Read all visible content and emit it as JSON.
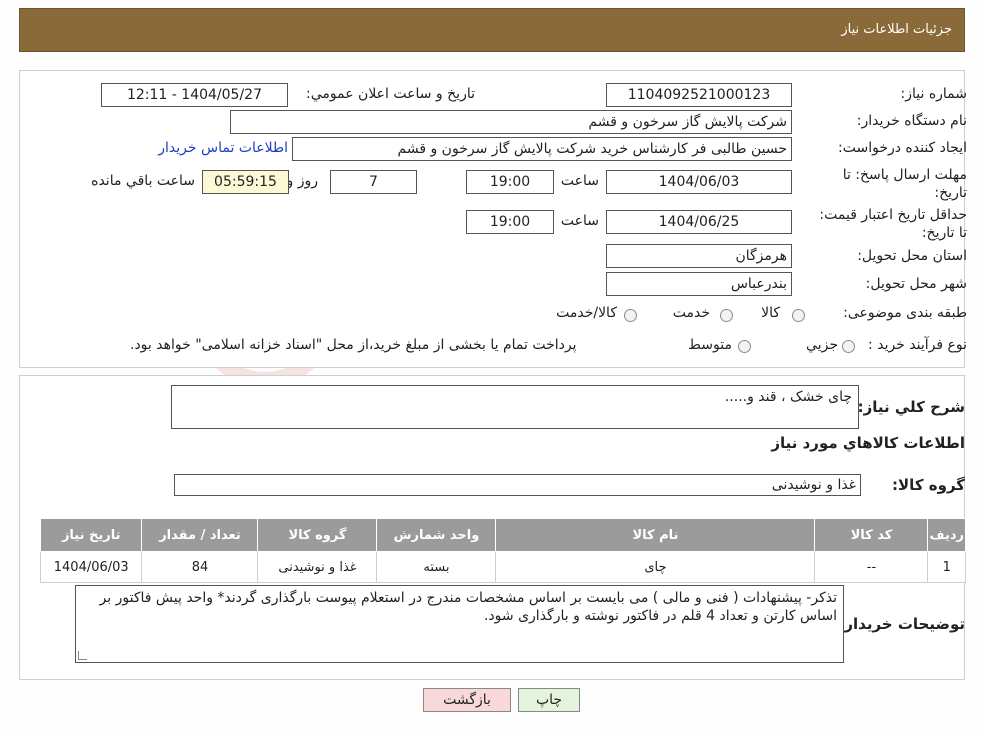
{
  "header": {
    "title": "جزئیات اطلاعات نیاز"
  },
  "info": {
    "need_number_label": "شماره نیاز:",
    "need_number": "1104092521000123",
    "announce_label": "تاریخ و ساعت اعلان عمومي:",
    "announce_value": "1404/05/27 - 12:11",
    "buyer_org_label": "نام دستگاه خریدار:",
    "buyer_org": "شرکت پالایش گاز سرخون و قشم",
    "creator_label": "ایجاد کننده درخواست:",
    "creator": "حسین طالبی فر کارشناس خرید شرکت پالایش گاز سرخون و قشم",
    "contact_link": "اطلاعات تماس خریدار",
    "deadline_label": "مهلت ارسال پاسخ: تا تاریخ:",
    "deadline_date": "1404/06/03",
    "time_label": "ساعت",
    "deadline_time": "19:00",
    "days": "7",
    "days_label": "روز و",
    "remaining": "05:59:15",
    "remaining_label": "ساعت باقي مانده",
    "price_validity_label": "حداقل تاریخ اعتبار قیمت: تا تاریخ:",
    "price_validity_date": "1404/06/25",
    "price_validity_time": "19:00",
    "province_label": "استان محل تحویل:",
    "province": "هرمزگان",
    "city_label": "شهر محل تحویل:",
    "city": "بندرعباس",
    "category_label": "طبقه بندی موضوعی:",
    "category_options": [
      "کالا",
      "خدمت",
      "کالا/خدمت"
    ],
    "process_label": "نوع فرآیند خرید :",
    "process_options": [
      "جزيي",
      "متوسط"
    ],
    "process_note": "پرداخت تمام یا بخشی از مبلغ خرید،از محل \"اسناد خزانه اسلامی\" خواهد بود."
  },
  "details": {
    "summary_label": "شرح كلي نياز:",
    "summary": "چای خشک ، قند و.....",
    "goods_info_title": "اطلاعات كالاهاي مورد نياز",
    "goods_group_label": "گروه كالا:",
    "goods_group": "غذا و نوشیدنی",
    "table": {
      "headers": [
        "رديف",
        "كد كالا",
        "نام كالا",
        "واحد شمارش",
        "گروه كالا",
        "تعداد / مقدار",
        "تاريخ نياز"
      ],
      "rows": [
        [
          "1",
          "--",
          "چای",
          "بسته",
          "غذا و نوشیدنی",
          "84",
          "1404/06/03"
        ]
      ]
    },
    "buyer_notes_label": "توضیحات خریدار:",
    "buyer_notes": "تذکر- پیشنهادات ( فنی و مالی ) می بایست بر اساس مشخصات مندرج در استعلام پیوست بارگذاری گردند* واحد پیش فاکتور بر اساس کارتن و تعداد 4 قلم در فاکتور نوشته و بارگذاری شود."
  },
  "buttons": {
    "print": "چاپ",
    "back": "بازگشت"
  },
  "colors": {
    "header_bg": "#8b6a3a",
    "table_header_bg": "#9b9b9b",
    "back_button_bg": "#f8d8d8",
    "print_button_bg": "#e4f4dc",
    "link": "#1a3fbf"
  }
}
